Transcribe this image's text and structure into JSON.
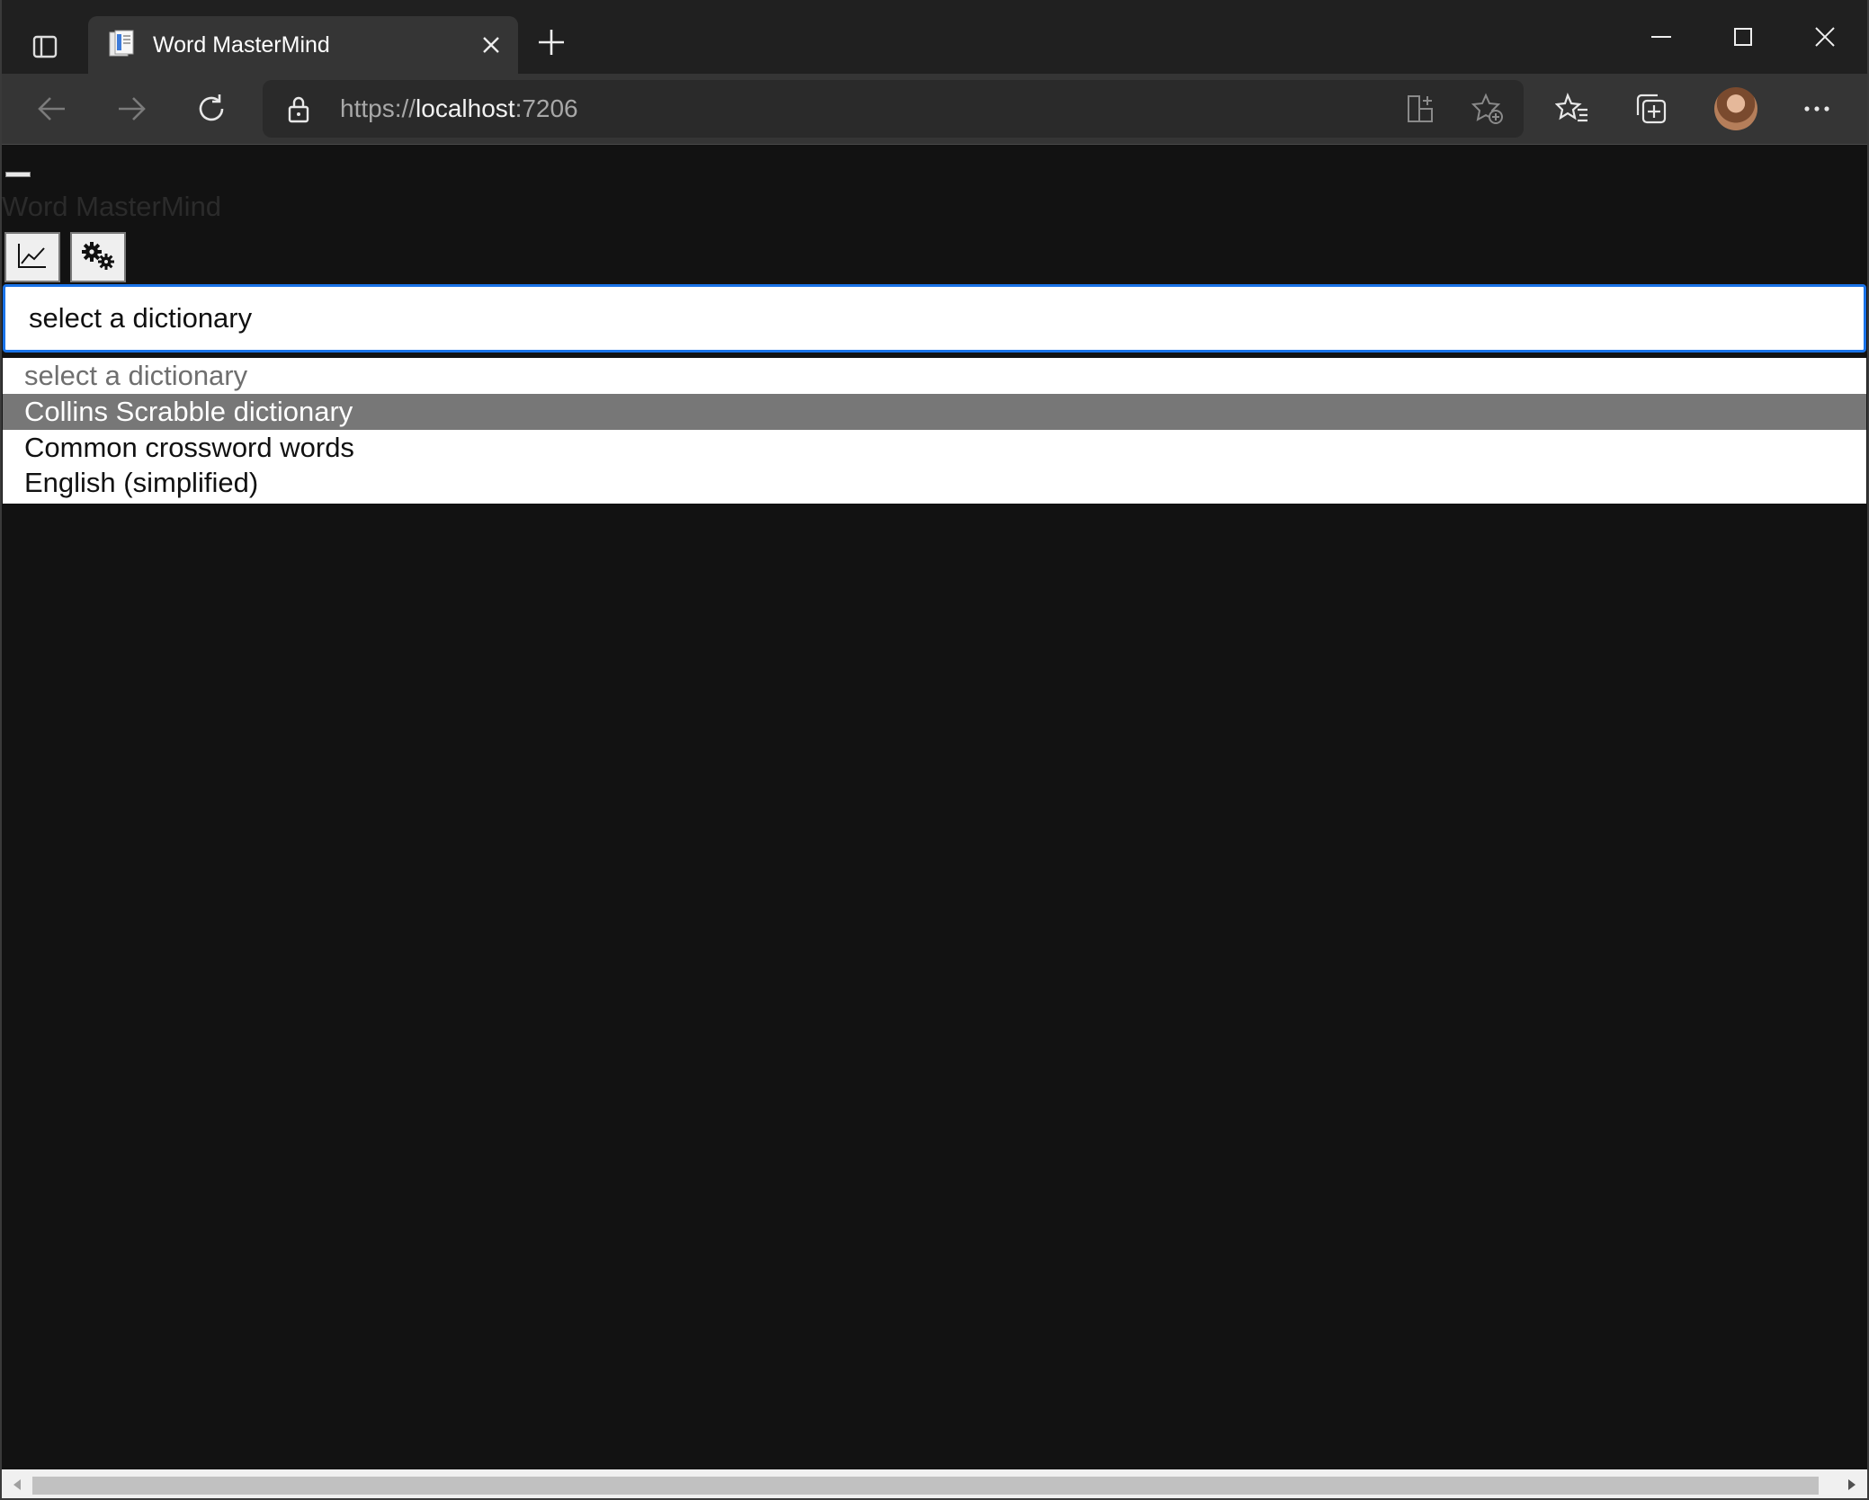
{
  "browser": {
    "tab": {
      "title": "Word MasterMind"
    },
    "url": {
      "scheme": "https://",
      "host": "localhost",
      "port": ":7206"
    }
  },
  "app": {
    "title": "Word MasterMind",
    "buttons": {
      "stats": "chart-line-icon",
      "settings": "gears-icon"
    },
    "dictionary_select": {
      "value": "select a dictionary",
      "options": [
        {
          "label": "select a dictionary",
          "state": "placeholder"
        },
        {
          "label": "Collins Scrabble dictionary",
          "state": "highlighted"
        },
        {
          "label": "Common crossword words",
          "state": "normal"
        },
        {
          "label": "English (simplified)",
          "state": "normal"
        }
      ]
    }
  },
  "colors": {
    "page_background": "#121212",
    "focus_ring": "#1a73e8",
    "highlighted_option": "#777777"
  }
}
